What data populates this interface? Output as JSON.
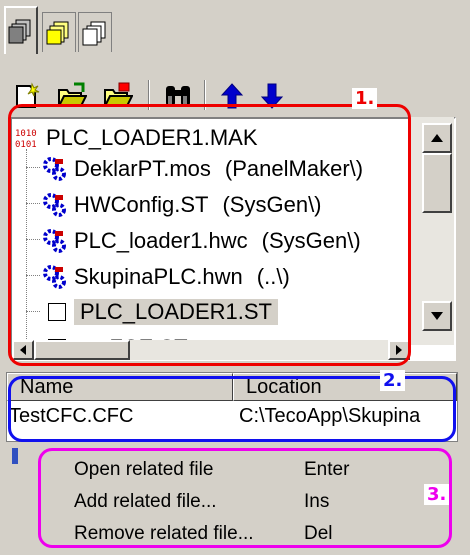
{
  "tabs": [
    {
      "icon": "objects-tab-icon",
      "active": true
    },
    {
      "icon": "files-tab-icon",
      "active": false
    },
    {
      "icon": "pages-tab-icon",
      "active": false
    }
  ],
  "toolbar": {
    "buttons": [
      "new-file-icon",
      "open-file-icon",
      "close-file-icon",
      "find-icon",
      "move-up-icon",
      "move-down-icon"
    ]
  },
  "tree": {
    "root": {
      "label": "PLC_LOADER1.MAK",
      "icon": "project-icon"
    },
    "items": [
      {
        "name": "DeklarPT.mos",
        "location": "(PanelMaker\\)"
      },
      {
        "name": "HWConfig.ST",
        "location": "(SysGen\\)"
      },
      {
        "name": "PLC_loader1.hwc",
        "location": "(SysGen\\)"
      },
      {
        "name": "SkupinaPLC.hwn",
        "location": "(..\\)"
      }
    ],
    "files": [
      {
        "name": "PLC_LOADER1.ST",
        "selected": true
      },
      {
        "name": "myFCE.ST",
        "selected": false
      }
    ]
  },
  "list": {
    "columns": [
      "Name",
      "Location"
    ],
    "rows": [
      {
        "name": "TestCFC.CFC",
        "location": "C:\\TecoApp\\Skupina"
      }
    ]
  },
  "context_menu": [
    {
      "label": "Open related file",
      "shortcut": "Enter"
    },
    {
      "label": "Add related file...",
      "shortcut": "Ins"
    },
    {
      "label": "Remove related file...",
      "shortcut": "Del"
    }
  ],
  "annotations": [
    {
      "label": "1.",
      "color": "#ee0000"
    },
    {
      "label": "2.",
      "color": "#1010ee"
    },
    {
      "label": "3.",
      "color": "#ee00ee"
    }
  ],
  "colors": {
    "face": "#d4d0c8",
    "accent_blue": "#0000cc"
  }
}
